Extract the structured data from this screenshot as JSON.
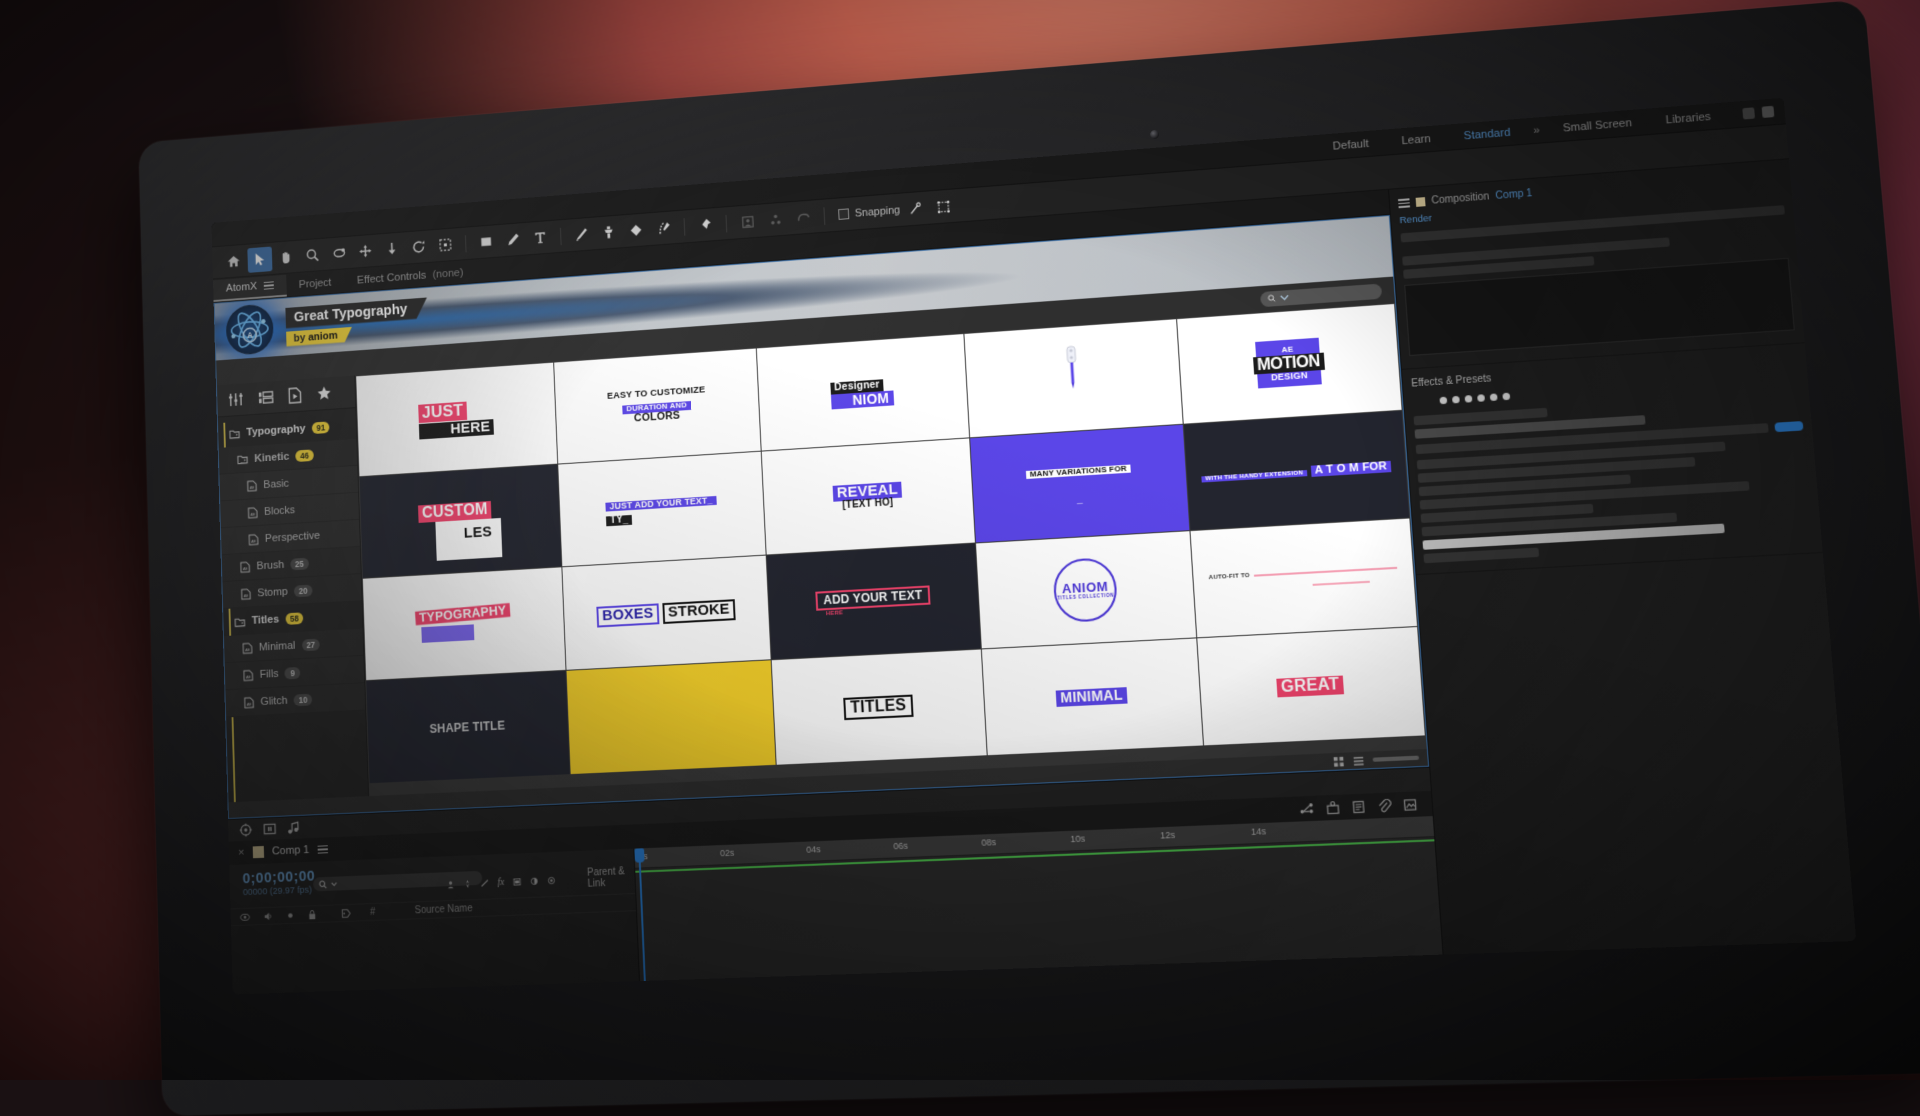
{
  "app": {
    "workspaces": [
      "Default",
      "Learn",
      "Standard",
      "Small Screen",
      "Libraries"
    ],
    "active_workspace": "Standard",
    "workspace_dots": "»"
  },
  "toolbar": {
    "snapping_label": "Snapping",
    "tools": [
      {
        "name": "home-icon",
        "glyph": "home"
      },
      {
        "name": "selection-tool",
        "glyph": "arrow"
      },
      {
        "name": "hand-tool",
        "glyph": "hand"
      },
      {
        "name": "zoom-tool",
        "glyph": "magnifier"
      },
      {
        "name": "rotation-tool",
        "glyph": "rotate-orbit"
      },
      {
        "name": "pan-behind-tool",
        "glyph": "anchor-move"
      },
      {
        "name": "puppet-pin-drop",
        "glyph": "arrow-down"
      },
      {
        "name": "rotate-tool",
        "glyph": "rotate"
      },
      {
        "name": "region-of-interest",
        "glyph": "dashed-box"
      },
      {
        "name": "shape-tool",
        "glyph": "rectangle"
      },
      {
        "name": "pen-tool",
        "glyph": "pen"
      },
      {
        "name": "type-tool",
        "glyph": "T"
      },
      {
        "name": "brush-tool",
        "glyph": "brush"
      },
      {
        "name": "clone-stamp-tool",
        "glyph": "stamp"
      },
      {
        "name": "eraser-tool",
        "glyph": "eraser"
      },
      {
        "name": "roto-brush-tool",
        "glyph": "roto-brush"
      },
      {
        "name": "puppet-pin-tool",
        "glyph": "pin"
      }
    ]
  },
  "panel_tabs": [
    {
      "label": "AtomX",
      "active": true,
      "suffix": ""
    },
    {
      "label": "Project",
      "active": false,
      "suffix": ""
    },
    {
      "label": "Effect Controls",
      "active": false,
      "suffix": "(none)"
    }
  ],
  "atomx": {
    "title": "Great Typography",
    "by_prefix": "by",
    "by_author": "aniom",
    "logo_letter": "A",
    "search_placeholder": "",
    "icon_tabs": [
      "sliders-icon",
      "library-icon",
      "file-play-icon",
      "star-icon"
    ],
    "tree": [
      {
        "label": "Typography",
        "count": "91",
        "level": 0,
        "accent": true,
        "icon": "folder-icon"
      },
      {
        "label": "Kinetic",
        "count": "46",
        "level": 1,
        "accent": true,
        "icon": "folder-icon"
      },
      {
        "label": "Basic",
        "count": "",
        "level": 2,
        "accent": false,
        "icon": "ae-file-icon"
      },
      {
        "label": "Blocks",
        "count": "",
        "level": 2,
        "accent": false,
        "icon": "ae-file-icon"
      },
      {
        "label": "Perspective",
        "count": "",
        "level": 2,
        "accent": false,
        "icon": "ae-file-icon"
      },
      {
        "label": "Brush",
        "count": "25",
        "level": 1,
        "accent": false,
        "icon": "ae-file-icon"
      },
      {
        "label": "Stomp",
        "count": "20",
        "level": 1,
        "accent": false,
        "icon": "ae-file-icon"
      },
      {
        "label": "Titles",
        "count": "58",
        "level": 0,
        "accent": true,
        "icon": "folder-icon"
      },
      {
        "label": "Minimal",
        "count": "27",
        "level": 1,
        "accent": false,
        "icon": "ae-file-icon"
      },
      {
        "label": "Fills",
        "count": "9",
        "level": 1,
        "accent": false,
        "icon": "ae-file-icon"
      },
      {
        "label": "Glitch",
        "count": "10",
        "level": 1,
        "accent": false,
        "icon": "ae-file-icon"
      }
    ],
    "thumbnails": [
      {
        "id": "just-here",
        "bg": "white",
        "lines": [
          {
            "text": "JUST",
            "style": "hl-pink",
            "size": 17
          },
          {
            "text": "HERE",
            "style": "hl-dark",
            "size": 15
          }
        ]
      },
      {
        "id": "easy-to-customize",
        "bg": "white",
        "lines": [
          {
            "text": "EASY TO CUSTOMIZE",
            "style": "plain",
            "size": 9
          },
          {
            "text": "DURATION AND",
            "style": "hl-violet",
            "size": 8
          },
          {
            "text": "COLORS",
            "style": "plain",
            "size": 10
          }
        ]
      },
      {
        "id": "designer-niom",
        "bg": "white",
        "lines": [
          {
            "text": "Designer",
            "style": "hl-dark",
            "size": 10
          },
          {
            "text": "NIOM",
            "style": "hl-violet",
            "size": 14
          }
        ]
      },
      {
        "id": "pen-stroke",
        "bg": "white",
        "lines": []
      },
      {
        "id": "ae-motion-design",
        "bg": "white",
        "lines": [
          {
            "text": "AE",
            "style": "hl-violet",
            "size": 8
          },
          {
            "text": "MOTION",
            "style": "hl-dark",
            "size": 16
          },
          {
            "text": "DESIGN",
            "style": "hl-violet",
            "size": 9
          }
        ]
      },
      {
        "id": "custom-styles",
        "bg": "dark",
        "lines": [
          {
            "text": "CUSTOM",
            "style": "hl-pink",
            "size": 16
          },
          {
            "text": "LES",
            "style": "hl-white",
            "size": 14
          }
        ]
      },
      {
        "id": "just-add-your-text",
        "bg": "white",
        "lines": [
          {
            "text": "JUST ADD YOUR TEXT_",
            "style": "hl-violet",
            "size": 9
          },
          {
            "text": "TY_",
            "style": "hl-dark",
            "size": 10
          }
        ]
      },
      {
        "id": "reveal-text",
        "bg": "white",
        "lines": [
          {
            "text": "REVEAL",
            "style": "hl-violet",
            "size": 15
          },
          {
            "text": "[TEXT HO]",
            "style": "plain",
            "size": 10
          }
        ]
      },
      {
        "id": "many-variations",
        "bg": "violet",
        "lines": [
          {
            "text": "MANY VARIATIONS FOR",
            "style": "hl-white",
            "size": 8
          },
          {
            "text": "_",
            "style": "plainw",
            "size": 10
          }
        ]
      },
      {
        "id": "handy-extension",
        "bg": "dark",
        "lines": [
          {
            "text": "WITH THE HANDY EXTENSION",
            "style": "hl-violet",
            "size": 6
          },
          {
            "text": "A T O M  FOR",
            "style": "hl-violet",
            "size": 11
          }
        ]
      },
      {
        "id": "typography",
        "bg": "white",
        "lines": [
          {
            "text": "TYPOGRAPHY",
            "style": "hl-pink",
            "size": 13
          },
          {
            "text": "",
            "style": "hl-dark",
            "size": 12
          }
        ]
      },
      {
        "id": "boxes-stroke",
        "bg": "white",
        "lines": [
          {
            "text": "BOXES",
            "style": "out-violet",
            "size": 15
          },
          {
            "text": "STROKE",
            "style": "out-dark",
            "size": 15
          }
        ]
      },
      {
        "id": "add-your-text",
        "bg": "dark",
        "lines": [
          {
            "text": "ADD YOUR TEXT",
            "style": "out-pink",
            "size": 12
          },
          {
            "text": "HERE",
            "style": "tiny-pink",
            "size": 6
          }
        ]
      },
      {
        "id": "aniom-titles-badge",
        "bg": "white",
        "lines": [
          {
            "text": "ANIOM",
            "style": "badge-circle",
            "size": 13
          },
          {
            "text": "TITLES COLLECTION",
            "style": "tiny-violet",
            "size": 5
          }
        ]
      },
      {
        "id": "auto-fit-to",
        "bg": "white",
        "lines": [
          {
            "text": "AUTO-FIT TO",
            "style": "tiny-dark",
            "size": 6
          }
        ]
      },
      {
        "id": "shape-title",
        "bg": "dark",
        "lines": [
          {
            "text": "SHAPE TITLE",
            "style": "plainw",
            "size": 12
          }
        ]
      },
      {
        "id": "yellow-block",
        "bg": "yellow",
        "lines": []
      },
      {
        "id": "titles-block",
        "bg": "white",
        "lines": [
          {
            "text": "TITLES",
            "style": "out-dark",
            "size": 16
          }
        ]
      },
      {
        "id": "minimal-block",
        "bg": "white",
        "lines": [
          {
            "text": "MINIMAL",
            "style": "hl-violet",
            "size": 14
          }
        ]
      },
      {
        "id": "great-block",
        "bg": "white",
        "lines": [
          {
            "text": "GREAT",
            "style": "hl-pink",
            "size": 16
          }
        ]
      }
    ]
  },
  "timeline": {
    "comp_name": "Comp 1",
    "timecode": "0;00;00;00",
    "frame_info": "00000 (29.97 fps)",
    "column_source": "Source Name",
    "column_parent": "Parent & Link",
    "ruler_ticks": [
      "0s",
      "02s",
      "04s",
      "06s",
      "08s",
      "10s",
      "12s",
      "14s"
    ],
    "search_placeholder": "",
    "switch_icons": [
      "eye-icon",
      "audio-icon",
      "solo-icon",
      "lock-icon",
      "label-icon",
      "number-icon"
    ],
    "layer_switch_icons": [
      "shy-icon",
      "collapse-icon",
      "quality-icon",
      "fx-icon",
      "frame-blend-icon",
      "motion-blur-icon",
      "adjustment-icon",
      "3d-icon"
    ],
    "preview_icons": [
      "motion-sketch-icon",
      "preview-icon",
      "audio-icon"
    ]
  },
  "right_panel": {
    "composition_label": "Composition",
    "comp_name": "Comp 1",
    "render_label": "Render",
    "effects_label": "Effects & Presets"
  }
}
